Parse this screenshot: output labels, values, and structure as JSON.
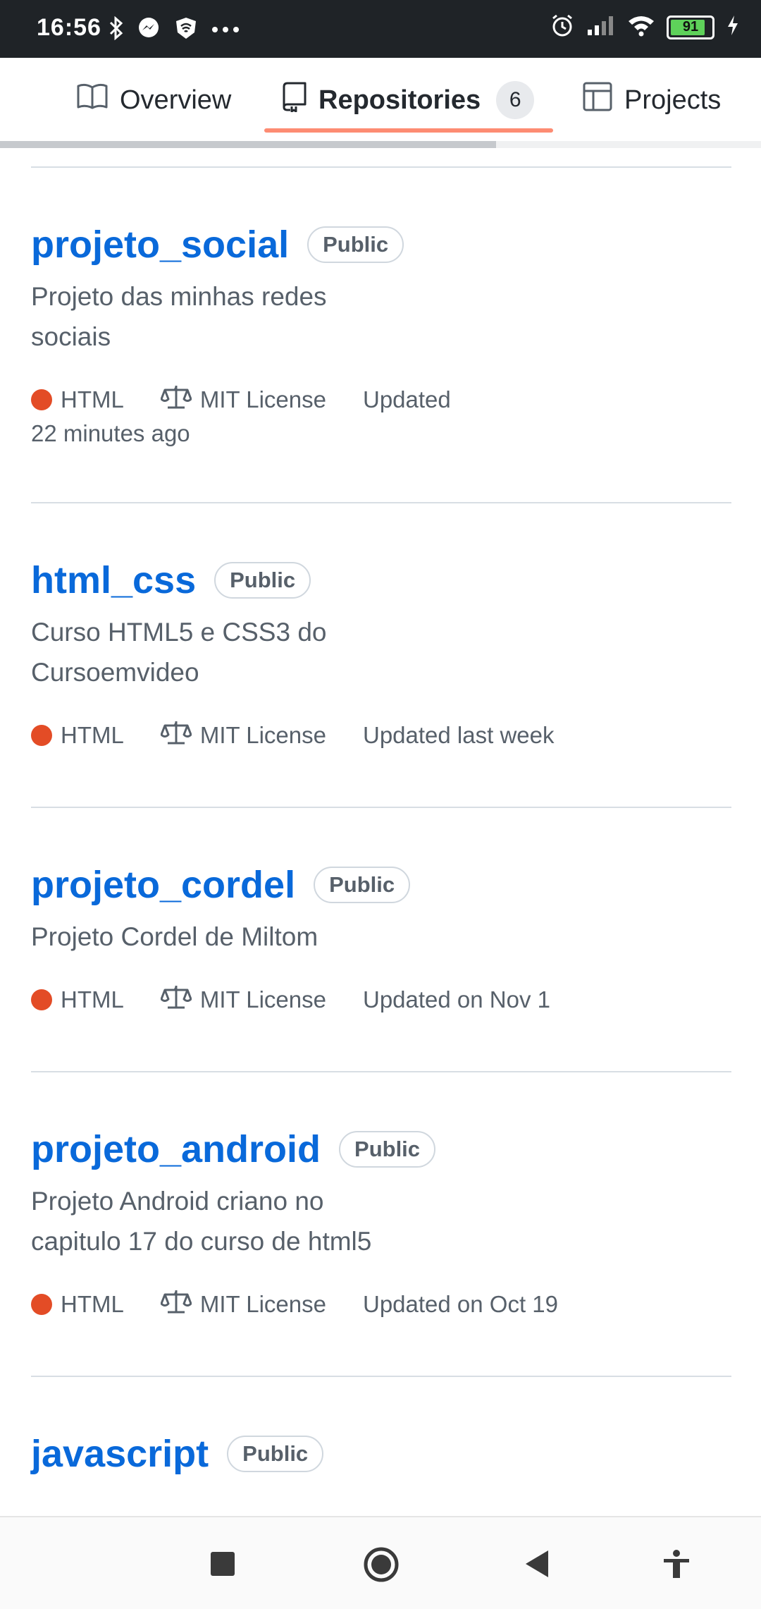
{
  "status_bar": {
    "time": "16:56",
    "battery": "91"
  },
  "tabs": {
    "overview": "Overview",
    "repositories": "Repositories",
    "repositories_count": "6",
    "projects": "Projects"
  },
  "repos": [
    {
      "name": "projeto_social",
      "visibility": "Public",
      "desc_line1": "Projeto das minhas redes",
      "desc_line2": "sociais",
      "language": "HTML",
      "license": "MIT License",
      "updated": "Updated",
      "updated_line2": "22 minutes ago"
    },
    {
      "name": "html_css",
      "visibility": "Public",
      "desc_line1": "Curso HTML5 e CSS3 do",
      "desc_line2": "Cursoemvideo",
      "language": "HTML",
      "license": "MIT License",
      "updated": "Updated last week"
    },
    {
      "name": "projeto_cordel",
      "visibility": "Public",
      "desc_line1": "Projeto Cordel de Miltom",
      "language": "HTML",
      "license": "MIT License",
      "updated": "Updated on Nov 1"
    },
    {
      "name": "projeto_android",
      "visibility": "Public",
      "desc_line1": "Projeto Android criano no",
      "desc_line2": "capitulo 17 do curso de html5",
      "language": "HTML",
      "license": "MIT License",
      "updated": "Updated on Oct 19"
    },
    {
      "name": "javascript",
      "visibility": "Public"
    }
  ],
  "colors": {
    "link": "#0969da",
    "html_lang": "#e34c26",
    "tab_underline": "#fd8c73"
  }
}
